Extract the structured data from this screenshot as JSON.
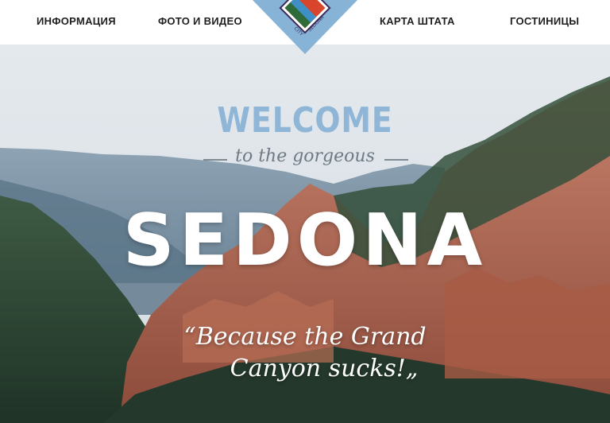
{
  "nav": {
    "items": [
      {
        "label": "ИНФОРМАЦИЯ"
      },
      {
        "label": "ФОТО И ВИДЕО"
      },
      {
        "label": "КАРТА ШТАТА"
      },
      {
        "label": "ГОСТИНИЦЫ"
      }
    ]
  },
  "logo": {
    "seal_text": "CITY OF SEDONA"
  },
  "hero": {
    "welcome": "WELCOME",
    "tagline": "to the gorgeous",
    "headline": "SEDONA",
    "quote_line1": "“Because the Grand",
    "quote_line2": "Canyon sucks!„"
  },
  "colors": {
    "accent_blue": "#8fb6d6",
    "nav_text": "#1f1f1f"
  }
}
